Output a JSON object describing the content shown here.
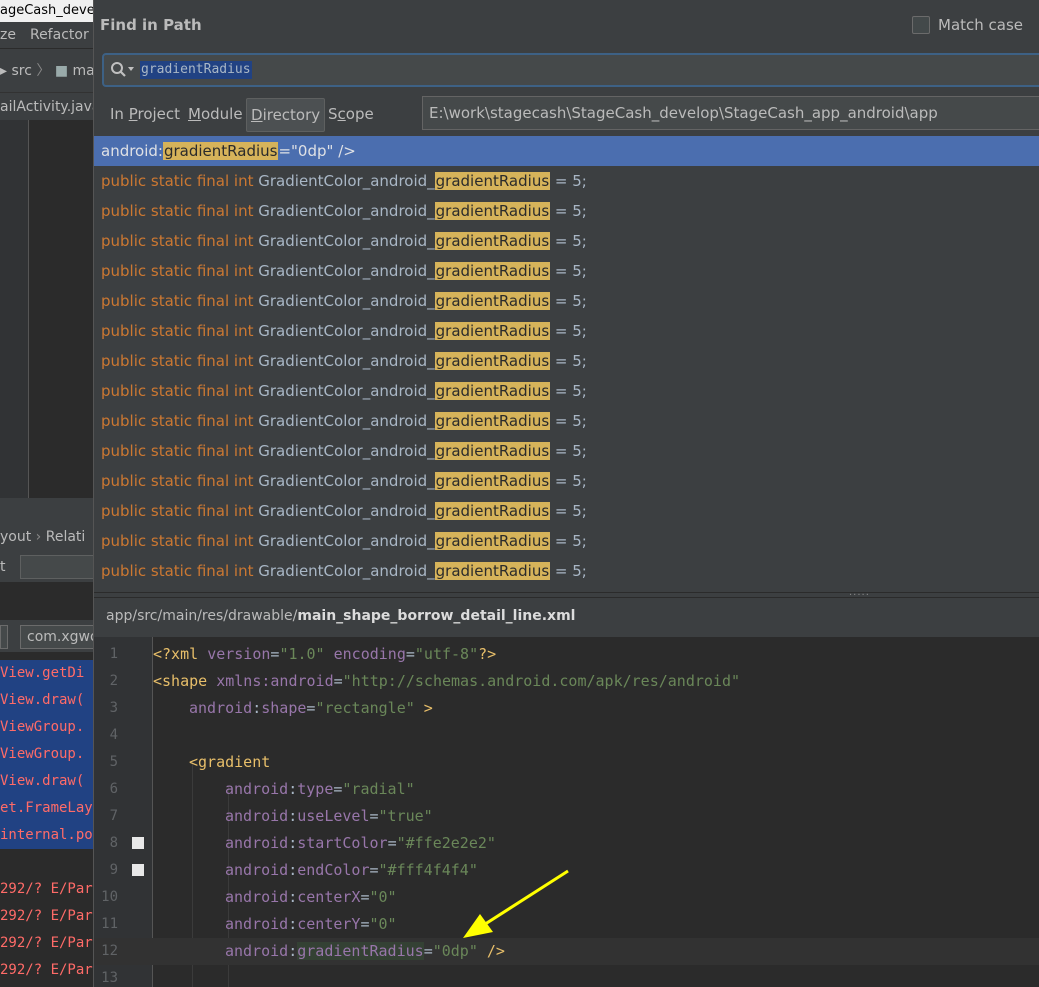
{
  "background_ide": {
    "window_title": "ageCash_develo",
    "menu": [
      "ze",
      "Refactor"
    ],
    "nav": [
      "src",
      "ma"
    ],
    "file_tab": "ailActivity.java",
    "breadcrumb": [
      "yout",
      "Relati"
    ],
    "sub_tab": "t",
    "logcat_filter": "com.xgwo",
    "log_lines": [
      {
        "text": "View.getDi",
        "selected": true
      },
      {
        "text": "View.draw(",
        "selected": true
      },
      {
        "text": "ViewGroup.",
        "selected": true
      },
      {
        "text": "ViewGroup.",
        "selected": true
      },
      {
        "text": "View.draw(",
        "selected": true
      },
      {
        "text": "et.FrameLay",
        "selected": true
      },
      {
        "text": "internal.po",
        "selected": true
      },
      {
        "text": "",
        "selected": false
      },
      {
        "text": "292/? E/Par",
        "selected": false
      },
      {
        "text": "292/? E/Par",
        "selected": false
      },
      {
        "text": "292/? E/Par",
        "selected": false
      },
      {
        "text": "292/? E/Par",
        "selected": false
      }
    ]
  },
  "dialog": {
    "title": "Find in Path",
    "match_case_label": "Match case",
    "match_case_checked": false,
    "search_query": "gradientRadius",
    "scope_tabs": [
      {
        "label": "In Project",
        "active": false
      },
      {
        "label": "Module",
        "active": false
      },
      {
        "label": "Directory",
        "active": true
      },
      {
        "label": "Scope",
        "active": false
      }
    ],
    "directory_path": "E:\\work\\stagecash\\StageCash_develop\\StageCash_app_android\\app",
    "results": {
      "selected": {
        "prefix": "android:",
        "match": "gradientRadius",
        "suffix": "=\"0dp\" />"
      },
      "repeated": {
        "keyword": "public static final int",
        "prefix": " GradientColor_android_",
        "match": "gradientRadius",
        "suffix": " = 5;",
        "count": 15
      }
    },
    "preview_path_dir": "app/src/main/res/drawable/",
    "preview_path_file": "main_shape_borrow_detail_line.xml",
    "preview_lines": [
      {
        "n": "1",
        "indent": 0,
        "tokens": [
          [
            "tag",
            "<?xml "
          ],
          [
            "attr",
            "version"
          ],
          [
            "plain",
            "="
          ],
          [
            "str",
            "\"1.0\""
          ],
          [
            "plain",
            " "
          ],
          [
            "attr",
            "encoding"
          ],
          [
            "plain",
            "="
          ],
          [
            "str",
            "\"utf-8\""
          ],
          [
            "tag",
            "?>"
          ]
        ]
      },
      {
        "n": "2",
        "indent": 0,
        "tokens": [
          [
            "tag",
            "<shape "
          ],
          [
            "attr",
            "xmlns:"
          ],
          [
            "attr",
            "android"
          ],
          [
            "plain",
            "="
          ],
          [
            "str",
            "\"http://schemas.android.com/apk/res/android\""
          ]
        ]
      },
      {
        "n": "3",
        "indent": 1,
        "tokens": [
          [
            "attr",
            "android"
          ],
          [
            "plain",
            ":"
          ],
          [
            "attr",
            "shape"
          ],
          [
            "plain",
            "="
          ],
          [
            "str",
            "\"rectangle\""
          ],
          [
            "tag",
            " >"
          ]
        ]
      },
      {
        "n": "4",
        "indent": 0,
        "tokens": []
      },
      {
        "n": "5",
        "indent": 1,
        "tokens": [
          [
            "tag",
            "<gradient"
          ]
        ]
      },
      {
        "n": "6",
        "indent": 2,
        "tokens": [
          [
            "attr",
            "android"
          ],
          [
            "plain",
            ":"
          ],
          [
            "attr",
            "type"
          ],
          [
            "plain",
            "="
          ],
          [
            "str",
            "\"radial\""
          ]
        ]
      },
      {
        "n": "7",
        "indent": 2,
        "tokens": [
          [
            "attr",
            "android"
          ],
          [
            "plain",
            ":"
          ],
          [
            "attr",
            "useLevel"
          ],
          [
            "plain",
            "="
          ],
          [
            "str",
            "\"true\""
          ]
        ]
      },
      {
        "n": "8",
        "indent": 2,
        "swatch": true,
        "tokens": [
          [
            "attr",
            "android"
          ],
          [
            "plain",
            ":"
          ],
          [
            "attr",
            "startColor"
          ],
          [
            "plain",
            "="
          ],
          [
            "str",
            "\"#ffe2e2e2\""
          ]
        ]
      },
      {
        "n": "9",
        "indent": 2,
        "swatch": true,
        "tokens": [
          [
            "attr",
            "android"
          ],
          [
            "plain",
            ":"
          ],
          [
            "attr",
            "endColor"
          ],
          [
            "plain",
            "="
          ],
          [
            "str",
            "\"#fff4f4f4\""
          ]
        ]
      },
      {
        "n": "10",
        "indent": 2,
        "tokens": [
          [
            "attr",
            "android"
          ],
          [
            "plain",
            ":"
          ],
          [
            "attr",
            "centerX"
          ],
          [
            "plain",
            "="
          ],
          [
            "str",
            "\"0\""
          ]
        ]
      },
      {
        "n": "11",
        "indent": 2,
        "tokens": [
          [
            "attr",
            "android"
          ],
          [
            "plain",
            ":"
          ],
          [
            "attr",
            "centerY"
          ],
          [
            "plain",
            "="
          ],
          [
            "str",
            "\"0\""
          ]
        ]
      },
      {
        "n": "12",
        "indent": 2,
        "current": true,
        "tokens": [
          [
            "attr",
            "android"
          ],
          [
            "plain",
            ":"
          ],
          [
            "match",
            "gradientRadius"
          ],
          [
            "plain",
            "="
          ],
          [
            "str",
            "\"0dp\""
          ],
          [
            "tag",
            " />"
          ]
        ]
      },
      {
        "n": "13",
        "indent": 0,
        "tokens": []
      }
    ]
  },
  "colors": {
    "selection": "#4b6eaf",
    "match_highlight": "#d6b35a",
    "keyword": "#cc7832",
    "annotation_arrow": "#ffff00"
  }
}
